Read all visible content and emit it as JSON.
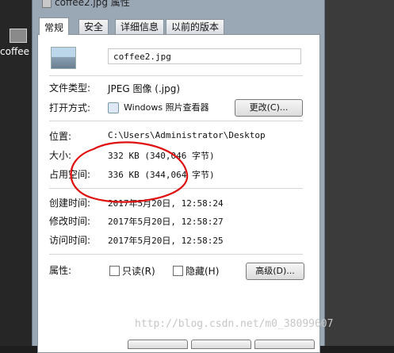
{
  "desktop": {
    "icon_label": "coffee"
  },
  "window": {
    "title": "coffee2.jpg 属性"
  },
  "tabs": [
    {
      "label": "常规"
    },
    {
      "label": "安全"
    },
    {
      "label": "详细信息"
    },
    {
      "label": "以前的版本"
    }
  ],
  "general": {
    "filename": "coffee2.jpg",
    "file_type_label": "文件类型:",
    "file_type_value": "JPEG 图像 (.jpg)",
    "open_with_label": "打开方式:",
    "open_with_value": "Windows 照片查看器",
    "change_button": "更改(C)...",
    "location_label": "位置:",
    "location_value": "C:\\Users\\Administrator\\Desktop",
    "size_label": "大小:",
    "size_value": "332 KB (340,046 字节)",
    "size_on_disk_label": "占用空间:",
    "size_on_disk_value": "336 KB (344,064 字节)",
    "created_label": "创建时间:",
    "created_value": "2017年5月20日, 12:58:24",
    "modified_label": "修改时间:",
    "modified_value": "2017年5月20日, 12:58:27",
    "accessed_label": "访问时间:",
    "accessed_value": "2017年5月20日, 12:58:25",
    "attributes_label": "属性:",
    "readonly_label": "只读(R)",
    "hidden_label": "隐藏(H)",
    "advanced_button": "高级(D)..."
  },
  "watermark": "http://blog.csdn.net/m0_38099607",
  "colors": {
    "annotation_circle": "#e01010"
  }
}
